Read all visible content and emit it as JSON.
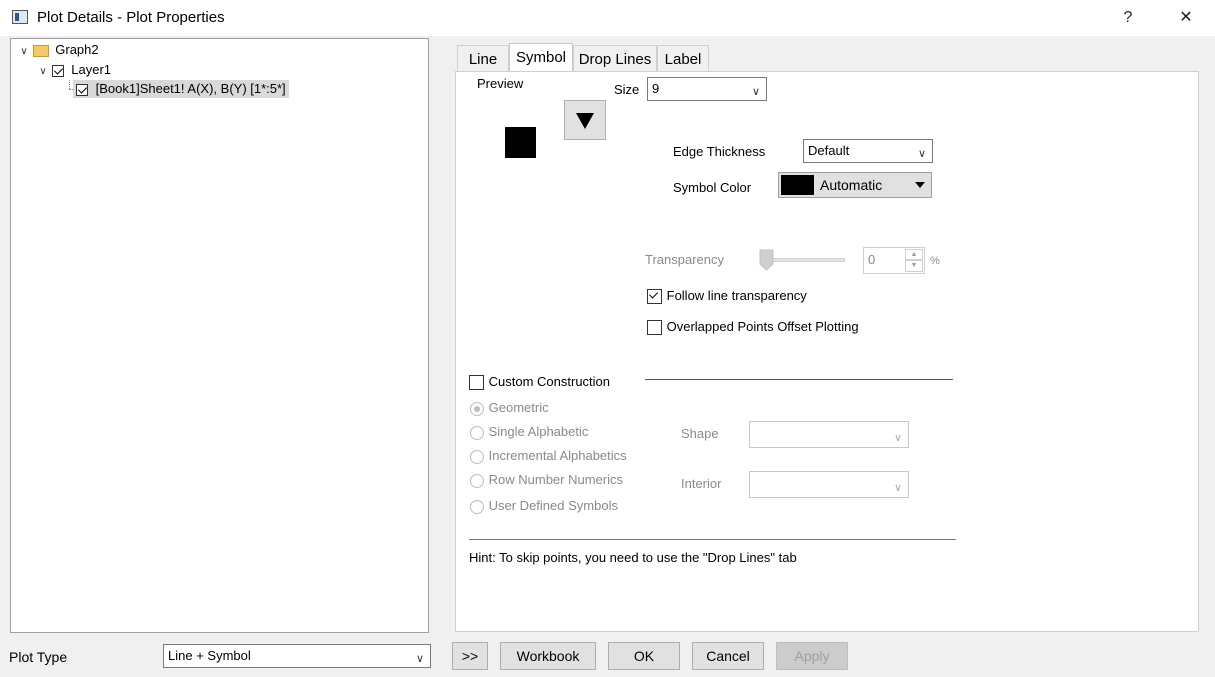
{
  "window": {
    "title": "Plot Details - Plot Properties",
    "help_label": "?",
    "close_label": "✕"
  },
  "tree": {
    "graph": "Graph2",
    "layer": "Layer1",
    "plot": "[Book1]Sheet1! A(X), B(Y) [1*:5*]"
  },
  "tabs": [
    {
      "label": "Line"
    },
    {
      "label": "Symbol"
    },
    {
      "label": "Drop Lines"
    },
    {
      "label": "Label"
    }
  ],
  "symbol": {
    "preview_label": "Preview",
    "size_label": "Size",
    "size_value": "9",
    "edge_thickness_label": "Edge Thickness",
    "edge_thickness_value": "Default",
    "symbol_color_label": "Symbol Color",
    "symbol_color_value": "Automatic",
    "symbol_color_swatch": "#000000",
    "transparency_label": "Transparency",
    "transparency_value": "0",
    "transparency_unit": "%",
    "follow_line_transparency_label": "Follow line transparency",
    "follow_line_transparency_checked": true,
    "overlapped_points_label": "Overlapped Points Offset Plotting",
    "overlapped_points_checked": false,
    "custom_construction_label": "Custom Construction",
    "construction_options": [
      {
        "label": "Geometric",
        "selected": true
      },
      {
        "label": "Single Alphabetic",
        "selected": false
      },
      {
        "label": "Incremental Alphabetics",
        "selected": false
      },
      {
        "label": "Row Number Numerics",
        "selected": false
      },
      {
        "label": "User Defined Symbols",
        "selected": false
      }
    ],
    "shape_label": "Shape",
    "interior_label": "Interior",
    "hint": "Hint: To skip points, you need to use the \"Drop Lines\" tab"
  },
  "footer": {
    "plot_type_label": "Plot Type",
    "plot_type_value": "Line + Symbol",
    "expand_label": ">>",
    "workbook_label": "Workbook",
    "ok_label": "OK",
    "cancel_label": "Cancel",
    "apply_label": "Apply"
  },
  "icons": [
    "app-icon",
    "folder-icon",
    "chevron-down-icon",
    "dropdown-arrow-icon",
    "spin-up-icon",
    "spin-down-icon",
    "down-triangle-symbol-icon"
  ]
}
